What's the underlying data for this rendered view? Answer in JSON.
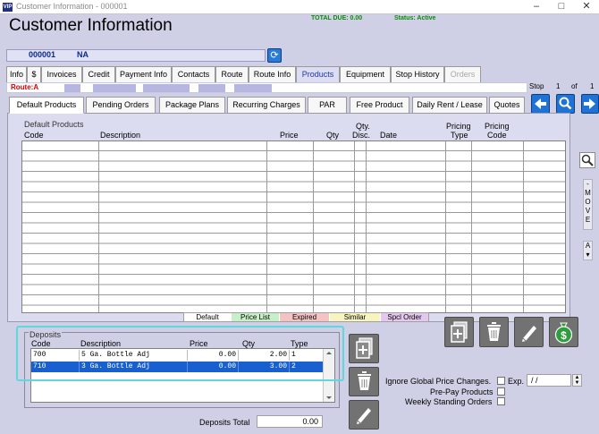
{
  "window": {
    "title": "Customer Information - 000001",
    "app_icon": "VIP"
  },
  "header": {
    "title": "Customer Information",
    "total_due": "TOTAL DUE:  0.00",
    "status": "Status: Active"
  },
  "customer": {
    "id": "000001",
    "name": "NA"
  },
  "tabs": [
    {
      "label": "Info"
    },
    {
      "label": "$"
    },
    {
      "label": "Invoices"
    },
    {
      "label": "Credit"
    },
    {
      "label": "Payment Info"
    },
    {
      "label": "Contacts"
    },
    {
      "label": "Route"
    },
    {
      "label": "Route Info"
    },
    {
      "label": "Products"
    },
    {
      "label": "Equipment"
    },
    {
      "label": "Stop History"
    },
    {
      "label": "Orders"
    }
  ],
  "route_label": "Route:A",
  "stop": {
    "label": "Stop",
    "current": "1",
    "of": "of",
    "total": "1"
  },
  "subtabs": [
    {
      "label": "Default Products"
    },
    {
      "label": "Pending Orders"
    },
    {
      "label": "Package Plans"
    },
    {
      "label": "Recurring Charges"
    },
    {
      "label": "PAR"
    },
    {
      "label": "Free Product"
    },
    {
      "label": "Daily Rent / Lease"
    },
    {
      "label": "Quotes"
    }
  ],
  "products": {
    "title": "Default Products",
    "columns": {
      "code": "Code",
      "description": "Description",
      "price": "Price",
      "qty": "Qty",
      "qty_disc_top": "Qty.",
      "qty_disc_bottom": "Disc.",
      "date": "Date",
      "pricing_type_top": "Pricing",
      "pricing_type_bottom": "Type",
      "pricing_code_top": "Pricing",
      "pricing_code_bottom": "Code"
    }
  },
  "legend": [
    {
      "label": "Default",
      "color": "#ffffff"
    },
    {
      "label": "Price List",
      "color": "#c8f0c8"
    },
    {
      "label": "Expired",
      "color": "#f4c4c4"
    },
    {
      "label": "Similar",
      "color": "#f8f4c0"
    },
    {
      "label": "Spcl Order",
      "color": "#e4c8f0"
    }
  ],
  "side_strip": {
    "move": [
      "M",
      "O",
      "V",
      "E"
    ],
    "a_label": "A"
  },
  "deposits": {
    "title": "Deposits",
    "columns": {
      "code": "Code",
      "description": "Description",
      "price": "Price",
      "qty": "Qty",
      "type": "Type"
    },
    "rows": [
      {
        "code": "700",
        "description": "5 Ga. Bottle Adj",
        "price": "0.00",
        "qty": "2.00",
        "type": "1"
      },
      {
        "code": "710",
        "description": "3 Ga. Bottle Adj",
        "price": "0.00",
        "qty": "3.00",
        "type": "2"
      }
    ],
    "total_label": "Deposits Total",
    "total_value": "0.00"
  },
  "options": {
    "ignore_global": "Ignore Global Price Changes.",
    "exp_label": "Exp.",
    "exp_value": "/ /",
    "prepay": "Pre-Pay Products",
    "weekly": "Weekly Standing Orders"
  },
  "colors": {
    "accent": "#1f73d6",
    "route": "#d40000",
    "status": "#0a8a0a",
    "highlight": "#5ed7dd",
    "selected_row": "#1860d0"
  }
}
